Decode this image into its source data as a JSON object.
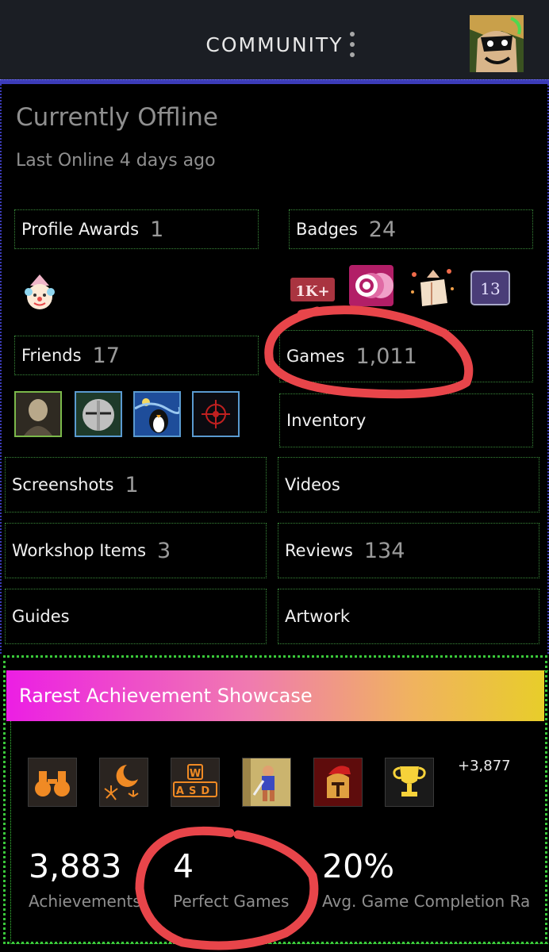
{
  "header": {
    "title": "COMMUNITY",
    "menu_icon": "kebab-menu-icon",
    "avatar_icon": "avatar"
  },
  "profile": {
    "status": "Currently Offline",
    "last_online": "Last Online 4 days ago"
  },
  "sections": {
    "profile_awards": {
      "label": "Profile Awards",
      "count": "1"
    },
    "badges": {
      "label": "Badges",
      "count": "24"
    },
    "friends": {
      "label": "Friends",
      "count": "17"
    },
    "games": {
      "label": "Games",
      "count": "1,011"
    },
    "inventory": {
      "label": "Inventory"
    },
    "screenshots": {
      "label": "Screenshots",
      "count": "1"
    },
    "videos": {
      "label": "Videos"
    },
    "workshop": {
      "label": "Workshop Items",
      "count": "3"
    },
    "reviews": {
      "label": "Reviews",
      "count": "134"
    },
    "guides": {
      "label": "Guides"
    },
    "artwork": {
      "label": "Artwork"
    }
  },
  "badge_icons": [
    "1k-badge-icon",
    "steam-badge-icon",
    "gift-badge-icon",
    "13-badge-icon"
  ],
  "badge_text": {
    "one_k": "1K+",
    "thirteen": "13"
  },
  "friend_avatars": [
    "friend-avatar-1",
    "friend-avatar-2",
    "friend-avatar-3",
    "friend-avatar-4"
  ],
  "showcase": {
    "title": "Rarest Achievement Showcase",
    "achievement_icons": [
      "binoculars-icon",
      "moon-fireworks-icon",
      "wasd-keys-icon",
      "warrior-icon",
      "spartan-helmet-icon",
      "trophy-icon"
    ],
    "wasd_top": "W",
    "wasd_bottom": "ASD",
    "more": "+3,877",
    "stats": [
      {
        "value": "3,883",
        "label": "Achievements"
      },
      {
        "value": "4",
        "label": "Perfect Games"
      },
      {
        "value": "20%",
        "label": "Avg. Game Completion Rate"
      }
    ]
  },
  "colors": {
    "header_bg": "#1b1e24",
    "annotation_red": "#e8454a",
    "blue_border": "#3b3bb8",
    "green_border": "#3ac93a"
  }
}
